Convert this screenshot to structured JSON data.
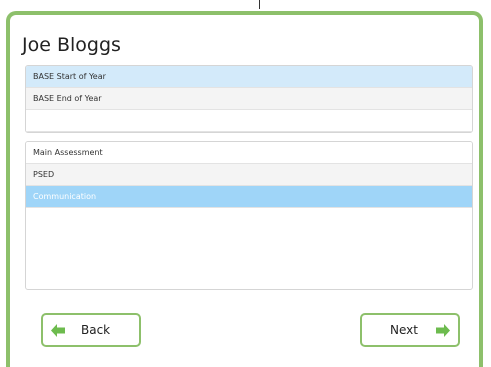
{
  "dialog": {
    "title": "Joe Bloggs"
  },
  "period_list": {
    "items": [
      {
        "label": "BASE Start of Year",
        "state": "selected"
      },
      {
        "label": "BASE End of Year",
        "state": "normal"
      },
      {
        "label": "",
        "state": "empty"
      }
    ]
  },
  "assessment_list": {
    "items": [
      {
        "label": "Main Assessment",
        "state": "normal"
      },
      {
        "label": "PSED",
        "state": "normal"
      },
      {
        "label": "Communication",
        "state": "selected"
      }
    ]
  },
  "buttons": {
    "back_label": "Back",
    "next_label": "Next"
  },
  "colors": {
    "border_green": "#8dc06b",
    "arrow_green": "#6dbb4e",
    "selected_blue": "#9fd5f8",
    "selected_light_blue": "#d3eafa"
  },
  "icons": {
    "back": "arrow-left-icon",
    "next": "arrow-right-icon"
  }
}
